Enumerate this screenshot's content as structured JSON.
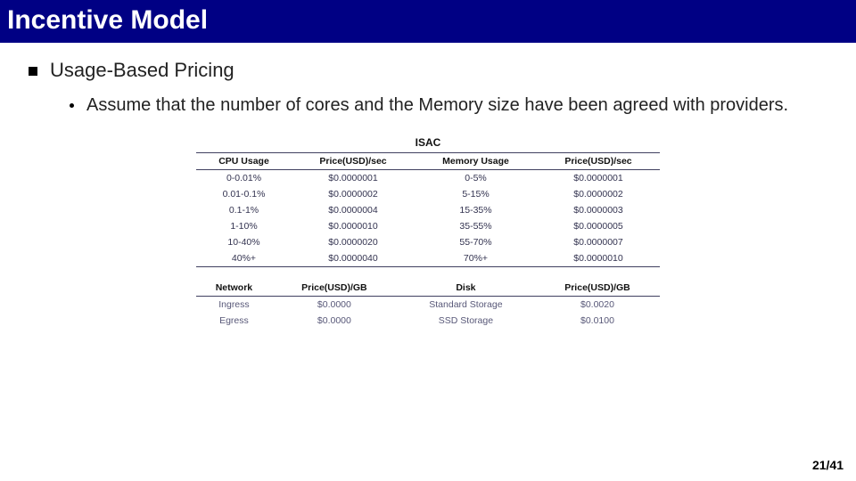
{
  "title": "Incentive Model",
  "section": "Usage-Based Pricing",
  "sub_bullet": "Assume that the number of cores and the Memory size have been agreed with providers.",
  "table_title": "ISAC",
  "headers": {
    "cpu": "CPU Usage",
    "cpu_price": "Price(USD)/sec",
    "mem": "Memory Usage",
    "mem_price": "Price(USD)/sec",
    "net": "Network",
    "net_price": "Price(USD)/GB",
    "disk": "Disk",
    "disk_price": "Price(USD)/GB"
  },
  "rows": [
    {
      "cpu": "0-0.01%",
      "cpu_price": "$0.0000001",
      "mem": "0-5%",
      "mem_price": "$0.0000001"
    },
    {
      "cpu": "0.01-0.1%",
      "cpu_price": "$0.0000002",
      "mem": "5-15%",
      "mem_price": "$0.0000002"
    },
    {
      "cpu": "0.1-1%",
      "cpu_price": "$0.0000004",
      "mem": "15-35%",
      "mem_price": "$0.0000003"
    },
    {
      "cpu": "1-10%",
      "cpu_price": "$0.0000010",
      "mem": "35-55%",
      "mem_price": "$0.0000005"
    },
    {
      "cpu": "10-40%",
      "cpu_price": "$0.0000020",
      "mem": "55-70%",
      "mem_price": "$0.0000007"
    },
    {
      "cpu": "40%+",
      "cpu_price": "$0.0000040",
      "mem": "70%+",
      "mem_price": "$0.0000010"
    }
  ],
  "net_rows": [
    {
      "name": "Ingress",
      "price": "$0.0000"
    },
    {
      "name": "Egress",
      "price": "$0.0000"
    }
  ],
  "disk_rows": [
    {
      "name": "Standard Storage",
      "price": "$0.0020"
    },
    {
      "name": "SSD Storage",
      "price": "$0.0100"
    }
  ],
  "page": "21/41"
}
